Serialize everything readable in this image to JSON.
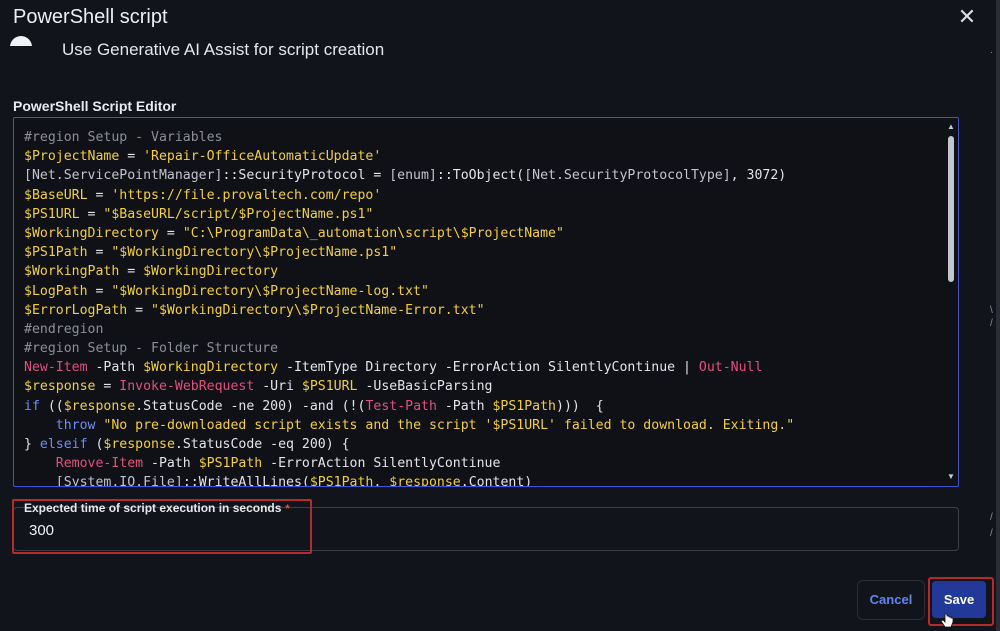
{
  "dialog": {
    "title": "PowerShell script",
    "close_icon": "close-icon"
  },
  "ai_toggle": {
    "label": "Use Generative AI Assist for script creation"
  },
  "editor": {
    "label": "PowerShell Script Editor",
    "colors": {
      "comment": "#8c8f9a",
      "variable": "#f2cf3a",
      "string": "#f2cf3a",
      "keyword": "#6f8cf0",
      "cmdlet": "#e0507a",
      "type": "#c1c4cc",
      "plain": "#e2e4ea"
    },
    "lines": [
      [
        [
          "comment",
          "#region Setup - Variables"
        ]
      ],
      [
        [
          "variable",
          "$ProjectName"
        ],
        [
          "plain",
          " = "
        ],
        [
          "string",
          "'Repair-OfficeAutomaticUpdate'"
        ]
      ],
      [
        [
          "type",
          "[Net.ServicePointManager]"
        ],
        [
          "plain",
          "::SecurityProtocol = "
        ],
        [
          "type",
          "[enum]"
        ],
        [
          "plain",
          "::ToObject("
        ],
        [
          "type",
          "[Net.SecurityProtocolType]"
        ],
        [
          "plain",
          ", 3072)"
        ]
      ],
      [
        [
          "variable",
          "$BaseURL"
        ],
        [
          "plain",
          " = "
        ],
        [
          "string",
          "'https://file.provaltech.com/repo'"
        ]
      ],
      [
        [
          "variable",
          "$PS1URL"
        ],
        [
          "plain",
          " = "
        ],
        [
          "string",
          "\"$BaseURL/script/$ProjectName.ps1\""
        ]
      ],
      [
        [
          "variable",
          "$WorkingDirectory"
        ],
        [
          "plain",
          " = "
        ],
        [
          "string",
          "\"C:\\ProgramData\\_automation\\script\\$ProjectName\""
        ]
      ],
      [
        [
          "variable",
          "$PS1Path"
        ],
        [
          "plain",
          " = "
        ],
        [
          "string",
          "\"$WorkingDirectory\\$ProjectName.ps1\""
        ]
      ],
      [
        [
          "variable",
          "$WorkingPath"
        ],
        [
          "plain",
          " = "
        ],
        [
          "variable",
          "$WorkingDirectory"
        ]
      ],
      [
        [
          "variable",
          "$LogPath"
        ],
        [
          "plain",
          " = "
        ],
        [
          "string",
          "\"$WorkingDirectory\\$ProjectName-log.txt\""
        ]
      ],
      [
        [
          "variable",
          "$ErrorLogPath"
        ],
        [
          "plain",
          " = "
        ],
        [
          "string",
          "\"$WorkingDirectory\\$ProjectName-Error.txt\""
        ]
      ],
      [
        [
          "comment",
          "#endregion"
        ]
      ],
      [
        [
          "comment",
          "#region Setup - Folder Structure"
        ]
      ],
      [
        [
          "cmdlet",
          "New-Item"
        ],
        [
          "plain",
          " -Path "
        ],
        [
          "variable",
          "$WorkingDirectory"
        ],
        [
          "plain",
          " -ItemType Directory -ErrorAction SilentlyContinue | "
        ],
        [
          "cmdlet",
          "Out-Null"
        ]
      ],
      [
        [
          "variable",
          "$response"
        ],
        [
          "plain",
          " = "
        ],
        [
          "cmdlet",
          "Invoke-WebRequest"
        ],
        [
          "plain",
          " -Uri "
        ],
        [
          "variable",
          "$PS1URL"
        ],
        [
          "plain",
          " -UseBasicParsing"
        ]
      ],
      [
        [
          "keyword",
          "if"
        ],
        [
          "plain",
          " (("
        ],
        [
          "variable",
          "$response"
        ],
        [
          "plain",
          ".StatusCode -ne 200) -and (!("
        ],
        [
          "cmdlet",
          "Test-Path"
        ],
        [
          "plain",
          " -Path "
        ],
        [
          "variable",
          "$PS1Path"
        ],
        [
          "plain",
          ")))  {"
        ]
      ],
      [
        [
          "plain",
          "    "
        ],
        [
          "keyword",
          "throw"
        ],
        [
          "plain",
          " "
        ],
        [
          "string",
          "\"No pre-downloaded script exists and the script '$PS1URL' failed to download. Exiting.\""
        ]
      ],
      [
        [
          "plain",
          "} "
        ],
        [
          "keyword",
          "elseif"
        ],
        [
          "plain",
          " ("
        ],
        [
          "variable",
          "$response"
        ],
        [
          "plain",
          ".StatusCode -eq 200) {"
        ]
      ],
      [
        [
          "plain",
          "    "
        ],
        [
          "cmdlet",
          "Remove-Item"
        ],
        [
          "plain",
          " -Path "
        ],
        [
          "variable",
          "$PS1Path"
        ],
        [
          "plain",
          " -ErrorAction SilentlyContinue"
        ]
      ],
      [
        [
          "plain",
          "    "
        ],
        [
          "type",
          "[System.IO.File]"
        ],
        [
          "plain",
          "::WriteAllLines("
        ],
        [
          "variable",
          "$PS1Path"
        ],
        [
          "plain",
          ", "
        ],
        [
          "variable",
          "$response"
        ],
        [
          "plain",
          ".Content)"
        ]
      ]
    ]
  },
  "execution_time": {
    "label": "Expected time of script execution in seconds",
    "required_mark": "*",
    "value": "300"
  },
  "footer": {
    "cancel_label": "Cancel",
    "save_label": "Save"
  },
  "side_glyphs": [
    ".",
    "\\",
    "/",
    "/",
    "/"
  ]
}
